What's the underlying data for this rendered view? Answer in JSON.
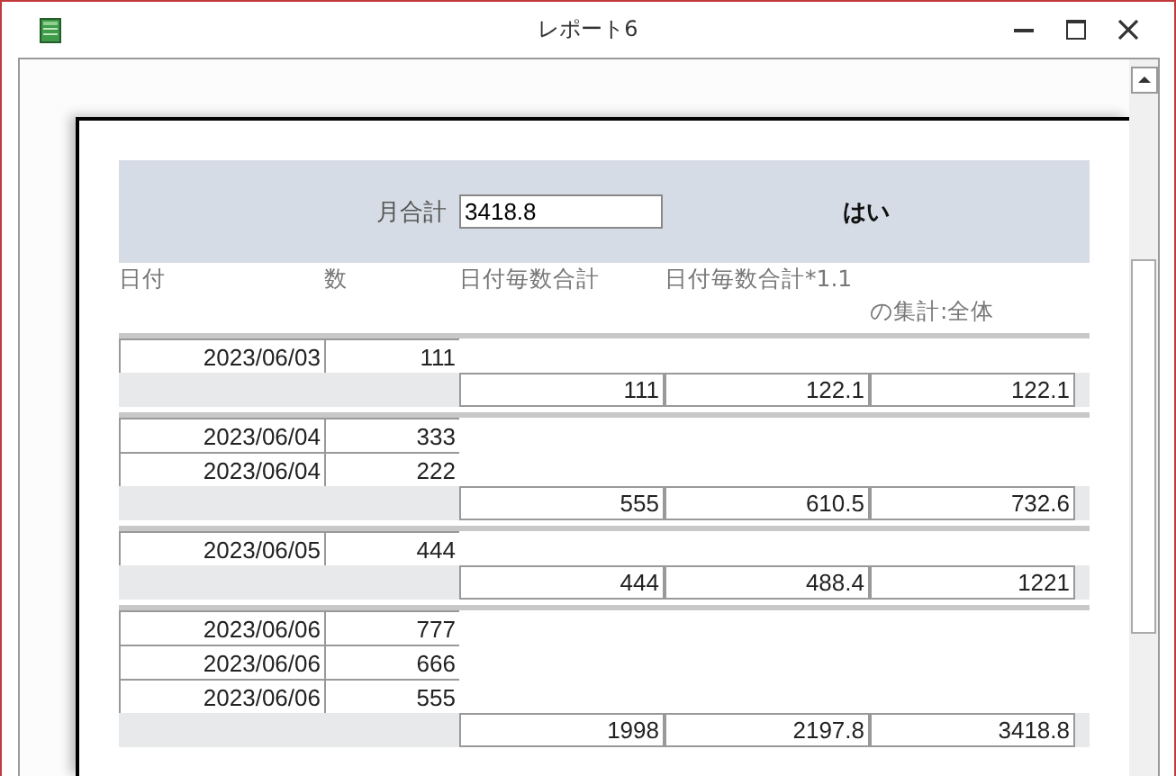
{
  "window": {
    "title": "レポート6"
  },
  "header": {
    "label": "月合計",
    "value": "3418.8",
    "flag": "はい"
  },
  "columns": [
    "日付",
    "数",
    "日付毎数合計",
    "日付毎数合計*1.1"
  ],
  "column_5": "の集計:全体",
  "groups": [
    {
      "rows": [
        {
          "date": "2023/06/03",
          "qty": "111"
        }
      ],
      "footer": [
        "111",
        "122.1",
        "122.1"
      ]
    },
    {
      "rows": [
        {
          "date": "2023/06/04",
          "qty": "333"
        },
        {
          "date": "2023/06/04",
          "qty": "222"
        }
      ],
      "footer": [
        "555",
        "610.5",
        "732.6"
      ]
    },
    {
      "rows": [
        {
          "date": "2023/06/05",
          "qty": "444"
        }
      ],
      "footer": [
        "444",
        "488.4",
        "1221"
      ]
    },
    {
      "rows": [
        {
          "date": "2023/06/06",
          "qty": "777"
        },
        {
          "date": "2023/06/06",
          "qty": "666"
        },
        {
          "date": "2023/06/06",
          "qty": "555"
        }
      ],
      "footer": [
        "1998",
        "2197.8",
        "3418.8"
      ]
    }
  ]
}
